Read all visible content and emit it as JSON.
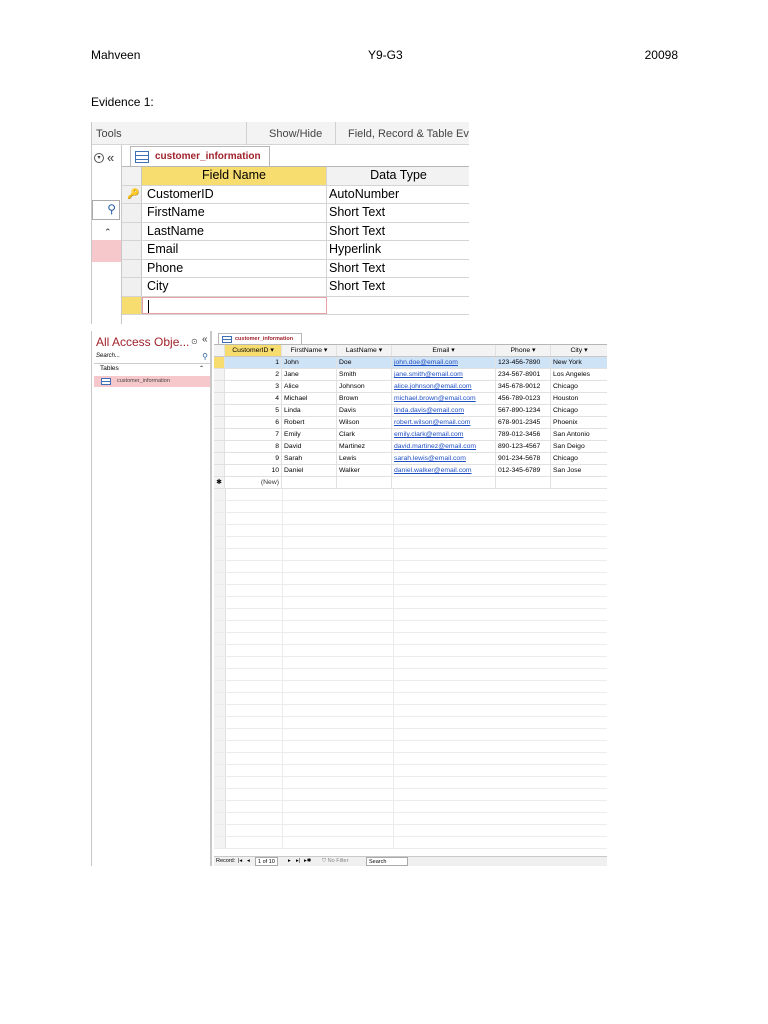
{
  "header": {
    "name": "Mahveen",
    "class": "Y9-G3",
    "id": "20098"
  },
  "evidence_label": "Evidence 1:",
  "design_view": {
    "ribbon": {
      "tools": "Tools",
      "show_hide": "Show/Hide",
      "field_events": "Field, Record & Table Eve"
    },
    "nav_collapse": "«",
    "tab_label": "customer_information",
    "headers": {
      "field_name": "Field Name",
      "data_type": "Data Type"
    },
    "rows": [
      {
        "field": "CustomerID",
        "type": "AutoNumber"
      },
      {
        "field": "FirstName",
        "type": "Short Text"
      },
      {
        "field": "LastName",
        "type": "Short Text"
      },
      {
        "field": "Email",
        "type": "Hyperlink"
      },
      {
        "field": "Phone",
        "type": "Short Text"
      },
      {
        "field": "City",
        "type": "Short Text"
      }
    ]
  },
  "datasheet_view": {
    "nav": {
      "title": "All Access Obje...",
      "circle": "⊙",
      "collapse": "«",
      "search_placeholder": "Search...",
      "group": "Tables",
      "group_chevron": "⌃",
      "item": "customer_information"
    },
    "tab_label": "customer_information",
    "columns": [
      "CustomerID",
      "FirstName",
      "LastName",
      "Email",
      "Phone",
      "City"
    ],
    "rows": [
      {
        "id": "1",
        "first": "John",
        "last": "Doe",
        "email": "john.doe@email.com",
        "phone": "123-456-7890",
        "city": "New York"
      },
      {
        "id": "2",
        "first": "Jane",
        "last": "Smith",
        "email": "jane.smith@email.com",
        "phone": "234-567-8901",
        "city": "Los Angeles"
      },
      {
        "id": "3",
        "first": "Alice",
        "last": "Johnson",
        "email": "alice.johnson@email.com",
        "phone": "345-678-9012",
        "city": "Chicago"
      },
      {
        "id": "4",
        "first": "Michael",
        "last": "Brown",
        "email": "michael.brown@email.com",
        "phone": "456-789-0123",
        "city": "Houston"
      },
      {
        "id": "5",
        "first": "Linda",
        "last": "Davis",
        "email": "linda.davis@email.com",
        "phone": "567-890-1234",
        "city": "Chicago"
      },
      {
        "id": "6",
        "first": "Robert",
        "last": "Wilson",
        "email": "robert.wilson@email.com",
        "phone": "678-901-2345",
        "city": "Phoenix"
      },
      {
        "id": "7",
        "first": "Emily",
        "last": "Clark",
        "email": "emily.clark@email.com",
        "phone": "789-012-3456",
        "city": "San Antonio"
      },
      {
        "id": "8",
        "first": "David",
        "last": "Martinez",
        "email": "david.martinez@email.com",
        "phone": "890-123-4567",
        "city": "San Deigo"
      },
      {
        "id": "9",
        "first": "Sarah",
        "last": "Lewis",
        "email": "sarah.lewis@email.com",
        "phone": "901-234-5678",
        "city": "Chicago"
      },
      {
        "id": "10",
        "first": "Daniel",
        "last": "Walker",
        "email": "daniel.walker@email.com",
        "phone": "012-345-6789",
        "city": "San Jose"
      }
    ],
    "new_row_marker": "✱",
    "new_row_label": "(New)",
    "record_bar": {
      "label": "Record:",
      "first": "|◂",
      "prev": "◂",
      "position": "1 of 10",
      "next": "▸",
      "last": "▸|",
      "new": "▸✱",
      "filter": "No Filter",
      "search": "Search"
    }
  }
}
